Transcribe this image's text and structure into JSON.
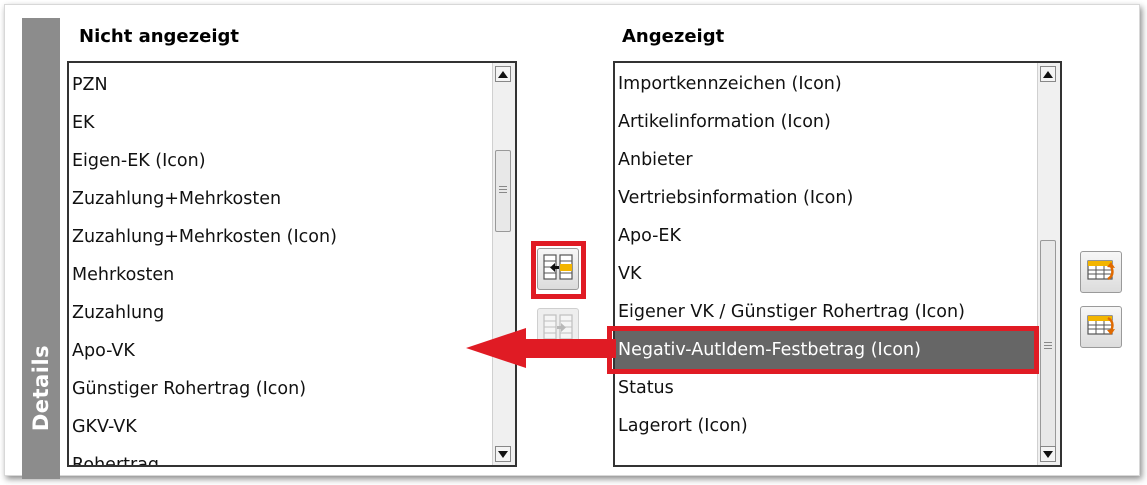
{
  "side_tab": {
    "label": "Details"
  },
  "left_list": {
    "heading": "Nicht angezeigt",
    "items": [
      "PZN",
      "EK",
      "Eigen-EK (Icon)",
      "Zuzahlung+Mehrkosten",
      "Zuzahlung+Mehrkosten (Icon)",
      "Mehrkosten",
      "Zuzahlung",
      "Apo-VK",
      "Günstiger Rohertrag (Icon)",
      "GKV-VK",
      "Rohertrag"
    ]
  },
  "right_list": {
    "heading": "Angezeigt",
    "selected_item": "Negativ-AutIdem-Festbetrag (Icon)",
    "items": [
      "Importkennzeichen (Icon)",
      "Artikelinformation (Icon)",
      "Anbieter",
      "Vertriebsinformation (Icon)",
      "Apo-EK",
      "VK",
      "Eigener VK / Günstiger Rohertrag (Icon)",
      "Negativ-AutIdem-Festbetrag (Icon)",
      "Status",
      "Lagerort (Icon)"
    ]
  },
  "buttons": {
    "move_left": {
      "icon": "move-to-hidden-icon",
      "enabled": true,
      "highlighted": true
    },
    "move_right": {
      "icon": "move-to-displayed-icon",
      "enabled": false
    },
    "move_up": {
      "icon": "move-column-up-icon",
      "enabled": true
    },
    "move_down": {
      "icon": "move-column-down-icon",
      "enabled": true
    }
  },
  "colors": {
    "highlight": "#e01b24",
    "selection": "#666666",
    "side_tab": "#8c8c8c"
  }
}
